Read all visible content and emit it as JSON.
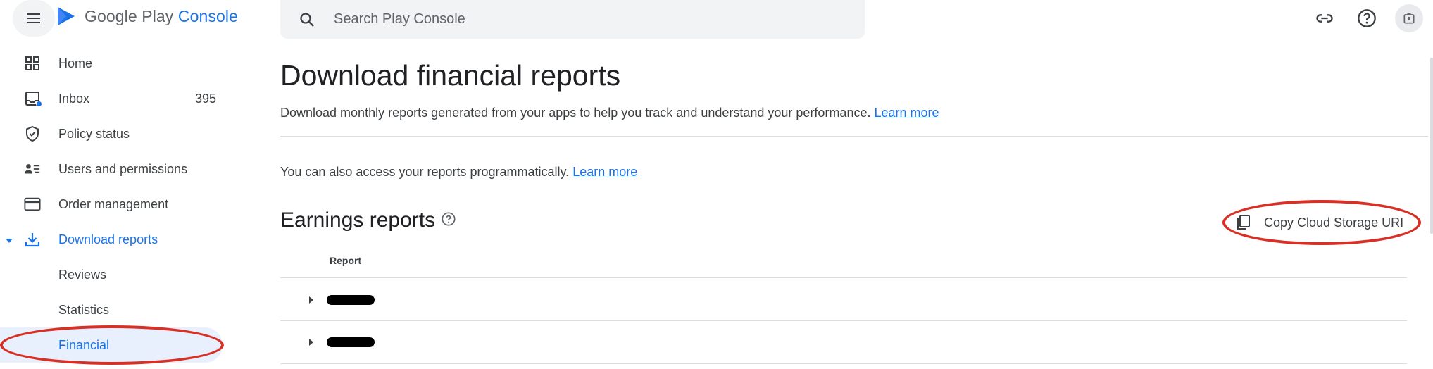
{
  "app": {
    "logo_text_main": "Google Play",
    "logo_text_accent": "Console"
  },
  "search": {
    "placeholder": "Search Play Console"
  },
  "sidebar": {
    "items": [
      {
        "label": "Home",
        "icon": "grid-icon"
      },
      {
        "label": "Inbox",
        "icon": "inbox-icon",
        "count": "395"
      },
      {
        "label": "Policy status",
        "icon": "shield-icon"
      },
      {
        "label": "Users and permissions",
        "icon": "people-list-icon"
      },
      {
        "label": "Order management",
        "icon": "credit-card-icon"
      },
      {
        "label": "Download reports",
        "icon": "download-icon",
        "expanded": true
      }
    ],
    "sub_items": [
      {
        "label": "Reviews"
      },
      {
        "label": "Statistics"
      },
      {
        "label": "Financial",
        "selected": true
      }
    ]
  },
  "main": {
    "title": "Download financial reports",
    "description": "Download monthly reports generated from your apps to help you track and understand your performance.",
    "description_link": "Learn more",
    "programmatic_text": "You can also access your reports programmatically.",
    "programmatic_link": "Learn more",
    "section_title": "Earnings reports",
    "copy_button_label": "Copy Cloud Storage URI",
    "table": {
      "column_header": "Report",
      "rows": [
        {
          "label": "[redacted]"
        },
        {
          "label": "[redacted]"
        }
      ]
    }
  },
  "colors": {
    "accent": "#1a73e8",
    "annotation": "#d93025",
    "selected_bg": "#e8f0fe"
  }
}
